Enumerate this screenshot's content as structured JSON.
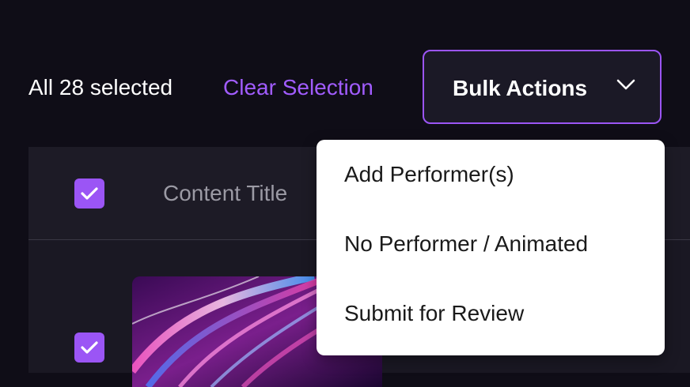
{
  "toolbar": {
    "selection_count": "All 28 selected",
    "clear_selection": "Clear Selection",
    "bulk_actions": "Bulk Actions"
  },
  "table": {
    "header": {
      "content_title": "Content Title"
    }
  },
  "dropdown": {
    "items": [
      {
        "label": "Add Performer(s)"
      },
      {
        "label": "No Performer / Animated"
      },
      {
        "label": "Submit for Review"
      }
    ]
  },
  "colors": {
    "background": "#0f0d17",
    "accent": "#9b55f5",
    "link": "#a15cff",
    "table_background": "#1a1823",
    "menu_background": "#ffffff"
  },
  "icons": [
    "chevron-down-icon",
    "checkmark-icon"
  ],
  "state": {
    "all_selected": true,
    "dropdown_open": true
  }
}
